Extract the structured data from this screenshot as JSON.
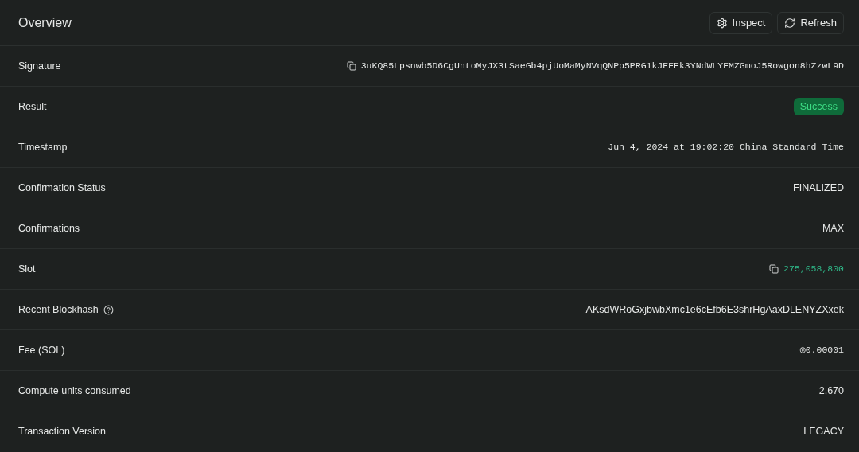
{
  "header": {
    "title": "Overview",
    "buttons": [
      {
        "label": "Inspect",
        "kind": "gear"
      },
      {
        "label": "Refresh",
        "kind": "refresh"
      }
    ]
  },
  "rows": [
    {
      "label": "Signature",
      "value": "3uKQ85Lpsnwb5D6CgUntoMyJX3tSaeGb4pjUoMaMyNVqQNPp5PRG1kJEEEk3YNdWLYEMZGmoJ5Rowgon8hZzwL9D",
      "kind": "mono",
      "copyable": true,
      "help": false
    },
    {
      "label": "Result",
      "value": "Success",
      "kind": "badge",
      "copyable": false,
      "help": false
    },
    {
      "label": "Timestamp",
      "value": "Jun 4, 2024 at 19:02:20 China Standard Time",
      "kind": "mono",
      "copyable": false,
      "help": false
    },
    {
      "label": "Confirmation Status",
      "value": "FINALIZED",
      "kind": "text",
      "copyable": false,
      "help": false
    },
    {
      "label": "Confirmations",
      "value": "MAX",
      "kind": "text",
      "copyable": false,
      "help": false
    },
    {
      "label": "Slot",
      "value": "275,058,800",
      "kind": "link",
      "copyable": true,
      "help": false
    },
    {
      "label": "Recent Blockhash",
      "value": "AKsdWRoGxjbwbXmc1e6cEfb6E3shrHgAaxDLENYZXxek",
      "kind": "text",
      "copyable": false,
      "help": true
    },
    {
      "label": "Fee (SOL)",
      "value": "◎0.00001",
      "kind": "mono",
      "copyable": false,
      "help": false
    },
    {
      "label": "Compute units consumed",
      "value": "2,670",
      "kind": "text",
      "copyable": false,
      "help": false
    },
    {
      "label": "Transaction Version",
      "value": "LEGACY",
      "kind": "text",
      "copyable": false,
      "help": false
    }
  ]
}
